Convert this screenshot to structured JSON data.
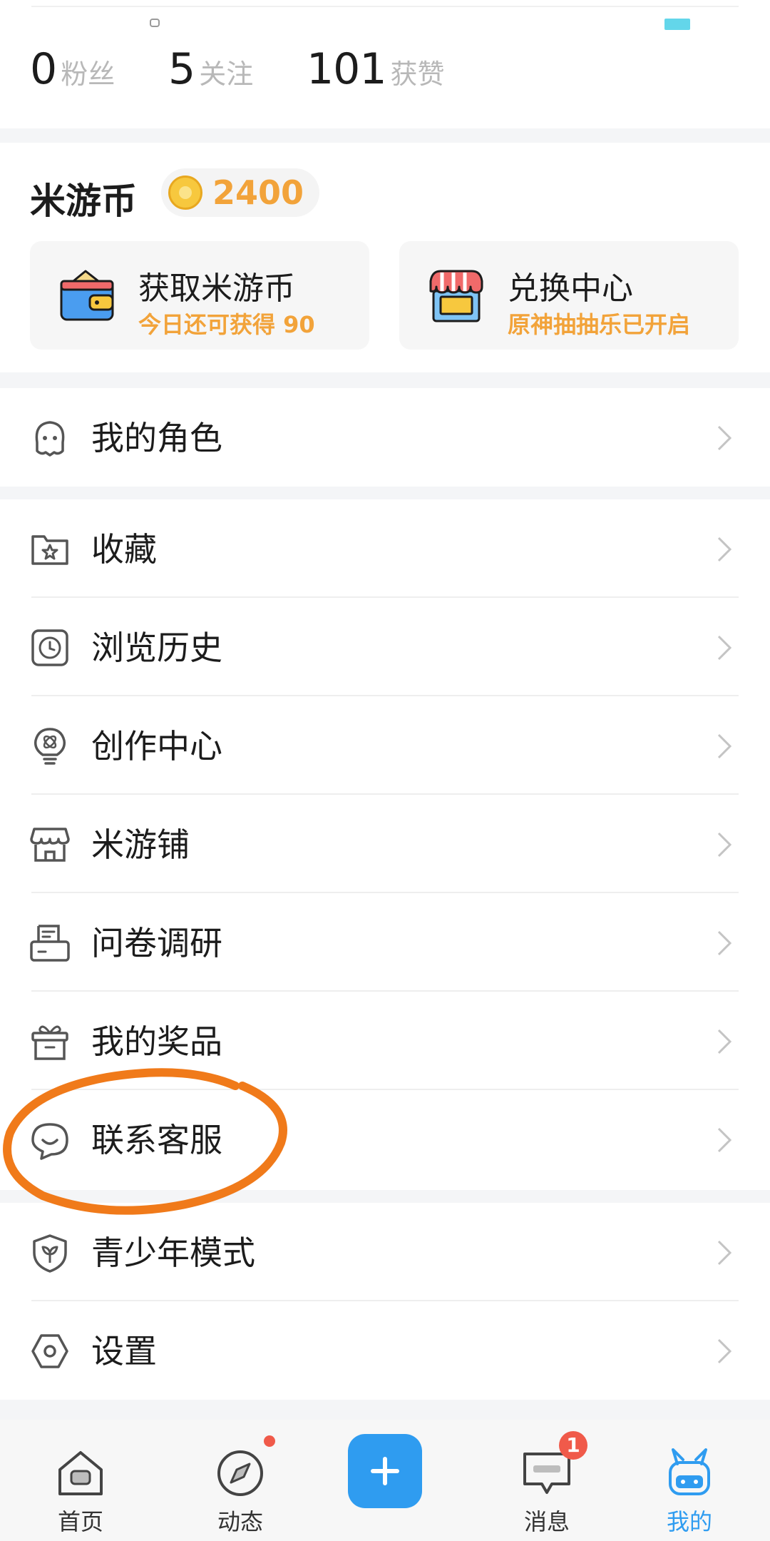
{
  "stats": [
    {
      "num": "0",
      "label": "粉丝"
    },
    {
      "num": "5",
      "label": "关注"
    },
    {
      "num": "101",
      "label": "获赞"
    }
  ],
  "coins": {
    "title": "米游币",
    "amount": "2400",
    "earn": {
      "title": "获取米游币",
      "subtitle": "今日还可获得 90"
    },
    "exchange": {
      "title": "兑换中心",
      "subtitle": "原神抽抽乐已开启"
    }
  },
  "menu_group1": [
    {
      "label": "我的角色",
      "icon": "character-icon"
    }
  ],
  "menu_group2": [
    {
      "label": "收藏",
      "icon": "star-folder-icon"
    },
    {
      "label": "浏览历史",
      "icon": "clock-icon"
    },
    {
      "label": "创作中心",
      "icon": "bulb-icon"
    },
    {
      "label": "米游铺",
      "icon": "store-icon"
    },
    {
      "label": "问卷调研",
      "icon": "survey-icon"
    },
    {
      "label": "我的奖品",
      "icon": "gift-icon"
    },
    {
      "label": "联系客服",
      "icon": "chat-smile-icon"
    }
  ],
  "menu_group3": [
    {
      "label": "青少年模式",
      "icon": "shield-leaf-icon"
    },
    {
      "label": "设置",
      "icon": "settings-icon"
    }
  ],
  "tabbar": [
    {
      "label": "首页",
      "icon": "home-icon"
    },
    {
      "label": "动态",
      "icon": "compass-icon"
    },
    {
      "label": "",
      "icon": "plus-icon"
    },
    {
      "label": "消息",
      "icon": "message-icon",
      "badge": "1"
    },
    {
      "label": "我的",
      "icon": "profile-bunny-icon",
      "active": true
    }
  ],
  "colors": {
    "accent": "#2f9cf0",
    "coin": "#f2a33a",
    "badge": "#f05a4a",
    "highlight": "#f07a1a"
  }
}
